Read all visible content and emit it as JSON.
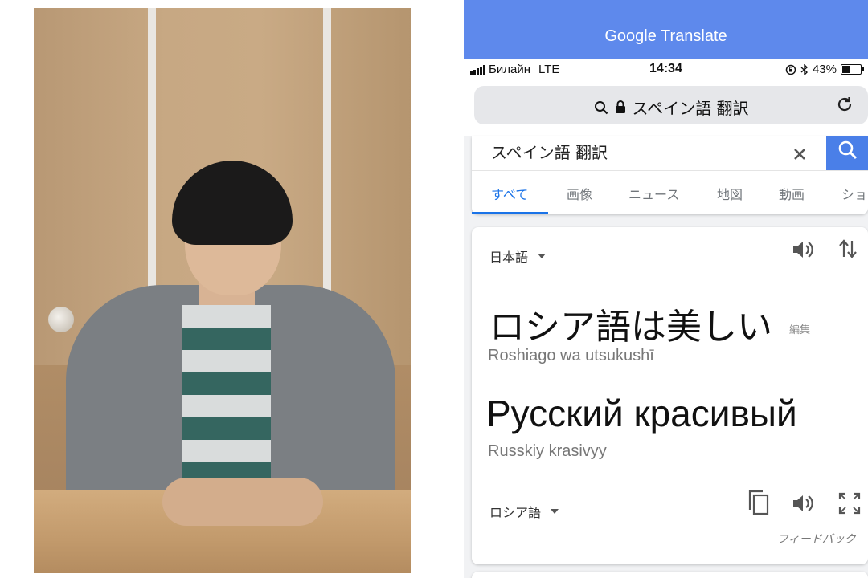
{
  "app": {
    "header_title": "Google Translate"
  },
  "status_bar": {
    "carrier": "Билайн",
    "network": "LTE",
    "time": "14:34",
    "battery": "43%",
    "battery_level": 0.43
  },
  "browser": {
    "url_text": "スペイン語 翻訳"
  },
  "search": {
    "query": "スペイン語 翻訳",
    "tabs": [
      {
        "label": "すべて",
        "active": true
      },
      {
        "label": "画像"
      },
      {
        "label": "ニュース"
      },
      {
        "label": "地図"
      },
      {
        "label": "動画"
      },
      {
        "label": "ショ"
      }
    ]
  },
  "translation": {
    "source_language": "日本語",
    "source_text": "ロシア語は美しい",
    "edit_label": "編集",
    "source_transliteration": "Roshiago wa utsukushī",
    "target_text": "Русский красивый",
    "target_transliteration": "Russkiy krasivyy",
    "target_language": "ロシア語",
    "feedback_label": "フィードバック"
  },
  "colors": {
    "header_blue": "#5e89ec",
    "search_blue": "#4a7fe8",
    "accent_blue": "#1a73e8"
  },
  "icons": [
    "search-icon",
    "lock-icon",
    "reload-icon",
    "close-icon",
    "speaker-icon",
    "swap-icon",
    "copy-icon",
    "fullscreen-icon",
    "bluetooth-icon",
    "rotation-lock-icon"
  ]
}
